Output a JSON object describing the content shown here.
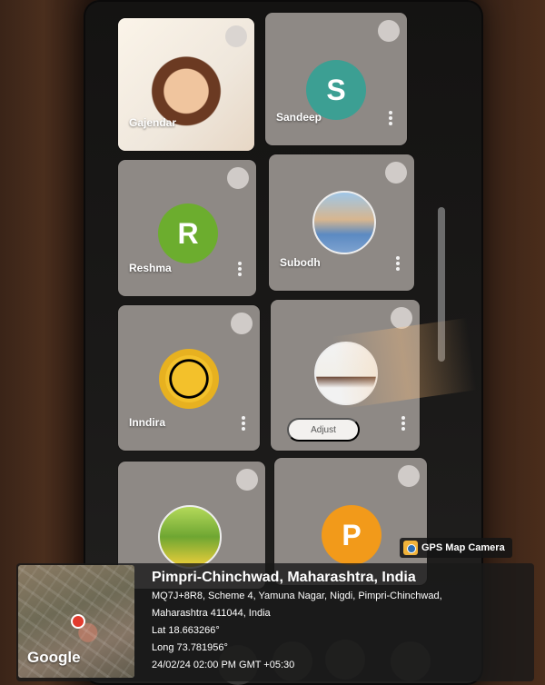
{
  "tiles": [
    {
      "name": "Gajendar",
      "type": "photo"
    },
    {
      "name": "Sandeep",
      "initial": "S",
      "color": "#3c9f93"
    },
    {
      "name": "Reshma",
      "initial": "R",
      "color": "#6cad2e"
    },
    {
      "name": "Subodh",
      "type": "photo"
    },
    {
      "name": "Inndira",
      "type": "photo"
    },
    {
      "name": "",
      "type": "photo",
      "button": "Adjust"
    },
    {
      "name": "",
      "type": "photo"
    },
    {
      "name": "",
      "initial": "P",
      "color": "#f29a1a"
    }
  ],
  "gps": {
    "badge": "GPS Map Camera",
    "title": "Pimpri-Chinchwad, Maharashtra, India",
    "address1": "MQ7J+8R8, Scheme 4, Yamuna Nagar, Nigdi, Pimpri-Chinchwad,",
    "address2": "Maharashtra 411044, India",
    "lat": "Lat 18.663266°",
    "long": "Long 73.781956°",
    "datetime": "24/02/24 02:00 PM GMT +05:30",
    "map_label": "Google"
  }
}
